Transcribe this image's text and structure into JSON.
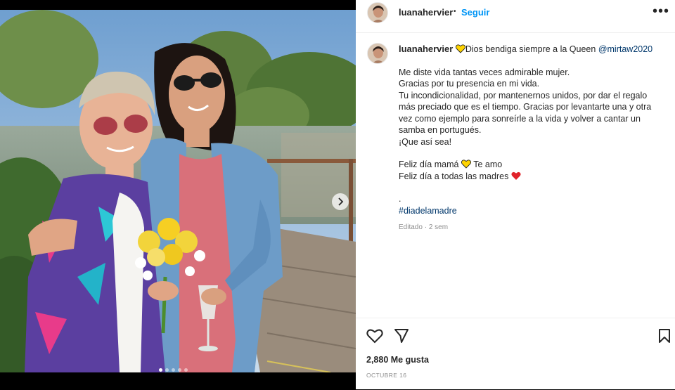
{
  "post": {
    "username": "luanahervier",
    "follow_label": "Seguir",
    "separator": "•",
    "more_label": "•••",
    "caption": {
      "intro": "Dios bendiga siempre a la Queen",
      "mention": "@mirtaw2020",
      "line1": "Me diste vida tantas veces admirable mujer.",
      "line2": "Gracias por tu presencia en mi vida.",
      "line3": "Tu incondicionalidad, por mantenernos unidos, por dar el regalo más preciado que es el tiempo. Gracias por levantarte una y otra vez como ejemplo para sonreírle a la vida y volver a cantar un samba en portugués.",
      "line4": "¡Que así sea!",
      "line5": "Feliz día mamá",
      "line5b": "Te amo",
      "line6": "Feliz día a todas las madres",
      "dot": ".",
      "hashtag": "#diadelamadre"
    },
    "edited": "Editado",
    "edited_sep": "·",
    "edited_time": "2 sem",
    "likes": "2,880 Me gusta",
    "date": "OCTUBRE 16",
    "carousel": {
      "count": 5,
      "active": 1
    },
    "colors": {
      "accent": "#0095f6",
      "link": "#00376b",
      "heart_yellow": "#ffd400",
      "heart_red": "#e0242b"
    },
    "icons": [
      "heart-icon",
      "comment-icon",
      "share-icon",
      "bookmark-icon",
      "chevron-right-icon",
      "more-icon"
    ]
  }
}
